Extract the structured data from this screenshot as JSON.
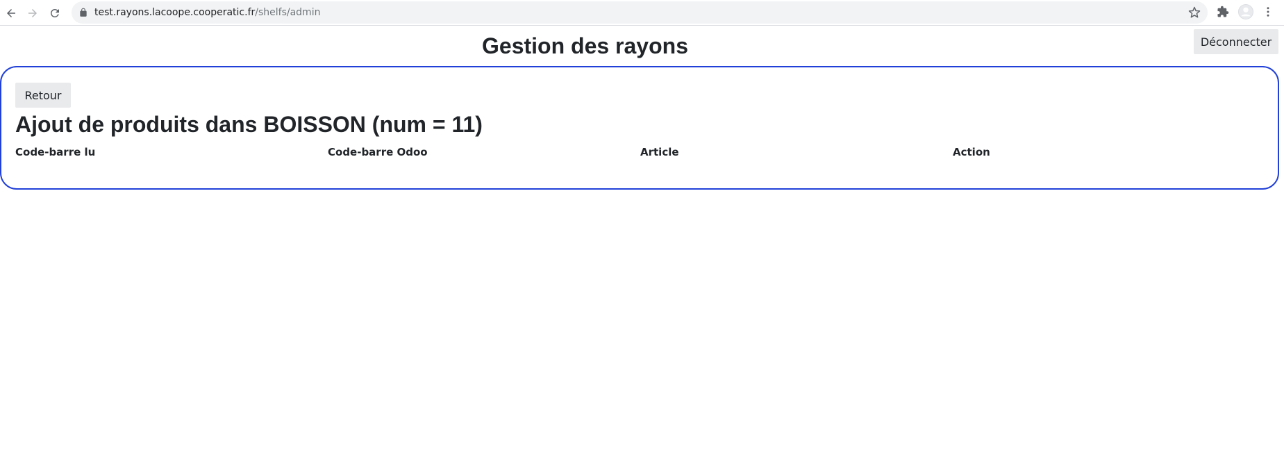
{
  "browser": {
    "url_host": "test.rayons.lacoope.cooperatic.fr",
    "url_path": "/shelfs/admin",
    "icons": [
      "back-arrow-icon",
      "forward-arrow-icon",
      "reload-icon",
      "lock-icon",
      "star-icon",
      "extensions-icon",
      "profile-avatar-icon",
      "more-menu-icon"
    ]
  },
  "header": {
    "title": "Gestion des rayons",
    "logout_label": "Déconnecter"
  },
  "panel": {
    "back_label": "Retour",
    "heading_prefix": "Ajout de produits dans",
    "heading_shelf": "BOISSON (num = 11)",
    "border_color": "#2140d8",
    "columns": [
      "Code-barre lu",
      "Code-barre Odoo",
      "Article",
      "Action"
    ],
    "rows": []
  }
}
